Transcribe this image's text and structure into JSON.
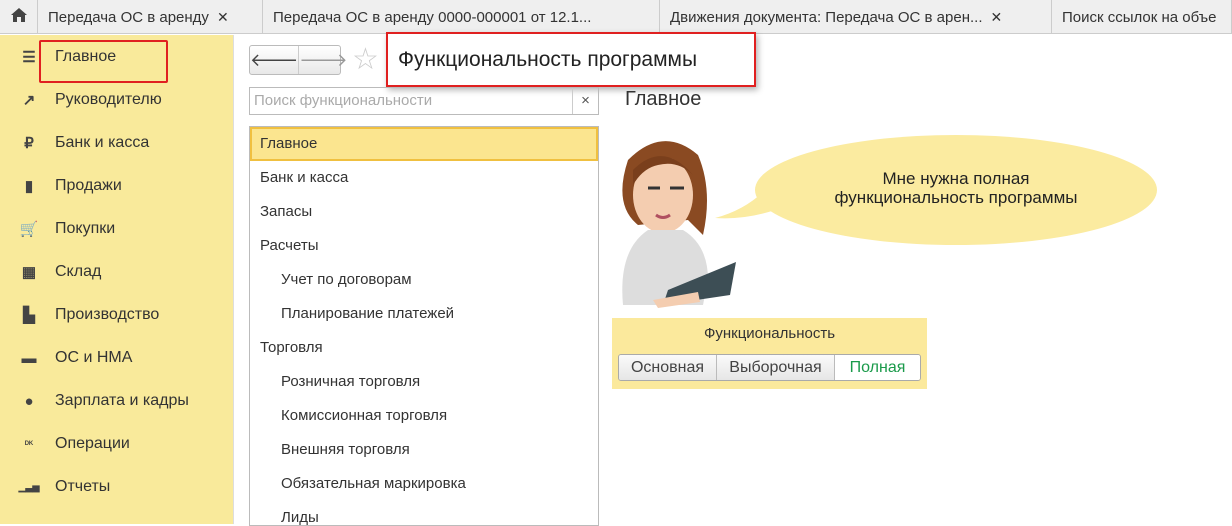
{
  "tabs": [
    {
      "label": "Передача ОС в аренду",
      "closable": true
    },
    {
      "label": "Передача ОС в аренду 0000-000001 от 12.1..."
    },
    {
      "label": "Движения документа: Передача ОС в арен..."
    },
    {
      "label": "Поиск ссылок на объе"
    }
  ],
  "sidebar": {
    "items": [
      {
        "label": "Главное",
        "icon": "menu-icon"
      },
      {
        "label": "Руководителю",
        "icon": "trend-icon"
      },
      {
        "label": "Банк и касса",
        "icon": "ruble-icon"
      },
      {
        "label": "Продажи",
        "icon": "bag-icon"
      },
      {
        "label": "Покупки",
        "icon": "cart-icon"
      },
      {
        "label": "Склад",
        "icon": "warehouse-icon"
      },
      {
        "label": "Производство",
        "icon": "factory-icon"
      },
      {
        "label": "ОС и НМА",
        "icon": "truck-icon"
      },
      {
        "label": "Зарплата и кадры",
        "icon": "person-icon"
      },
      {
        "label": "Операции",
        "icon": "dt-kt-icon"
      },
      {
        "label": "Отчеты",
        "icon": "chart-icon"
      }
    ]
  },
  "window": {
    "title": "Функциональность программы"
  },
  "search": {
    "placeholder": "Поиск функциональности",
    "clear": "×"
  },
  "list": [
    {
      "label": "Главное",
      "level": 0,
      "selected": true
    },
    {
      "label": "Банк и касса",
      "level": 0
    },
    {
      "label": "Запасы",
      "level": 0
    },
    {
      "label": "Расчеты",
      "level": 0
    },
    {
      "label": "Учет по договорам",
      "level": 1
    },
    {
      "label": "Планирование платежей",
      "level": 1
    },
    {
      "label": "Торговля",
      "level": 0
    },
    {
      "label": "Розничная торговля",
      "level": 1
    },
    {
      "label": "Комиссионная торговля",
      "level": 1
    },
    {
      "label": "Внешняя торговля",
      "level": 1
    },
    {
      "label": "Обязательная маркировка",
      "level": 1
    },
    {
      "label": "Лиды",
      "level": 1
    }
  ],
  "main": {
    "heading": "Главное",
    "bubble_line1": "Мне нужна полная",
    "bubble_line2": "функциональность программы",
    "panel_title": "Функциональность",
    "options": [
      "Основная",
      "Выборочная",
      "Полная"
    ],
    "selected_option": "Полная"
  }
}
